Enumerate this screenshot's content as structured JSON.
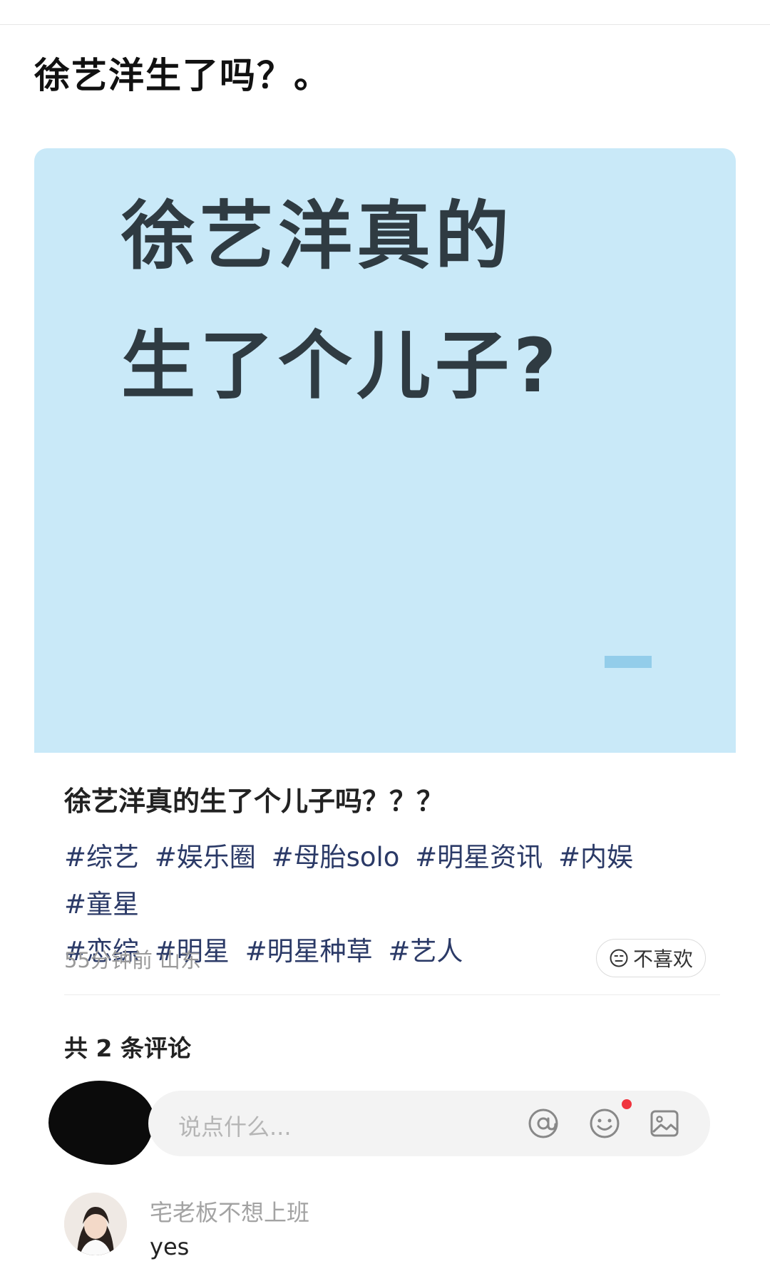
{
  "page": {
    "heading": "徐艺洋生了吗？。"
  },
  "cover": {
    "line1": "徐艺洋真的",
    "line2": "生了个儿子?"
  },
  "post": {
    "title": "徐艺洋真的生了个儿子吗？？？",
    "tags": [
      "#综艺",
      "#娱乐圈",
      "#母胎solo",
      "#明星资讯",
      "#内娱",
      "#童星",
      "#恋综",
      "#明星",
      "#明星种草",
      "#艺人"
    ],
    "time": "55分钟前",
    "location": "山东",
    "dislike_label": "不喜欢"
  },
  "comments": {
    "count_label": "共 2 条评论",
    "input_placeholder": "说点什么...",
    "icons": [
      "at-icon",
      "emoji-icon",
      "image-icon"
    ],
    "list": [
      {
        "user": "宅老板不想上班",
        "text": "yes"
      }
    ]
  },
  "colors": {
    "cover_bg": "#c9e9f8",
    "cover_text": "#2f3b42",
    "tag_text": "#2b3a67",
    "notification_dot": "#f0343e"
  }
}
